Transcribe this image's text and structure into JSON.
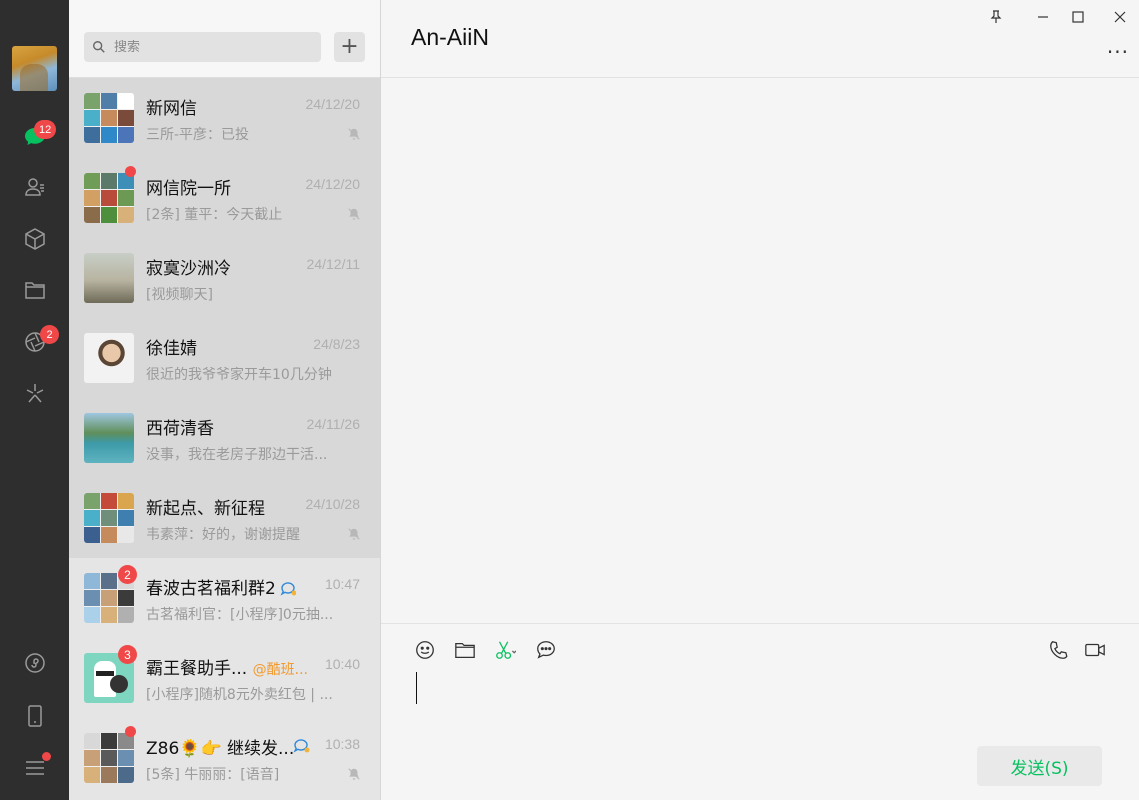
{
  "nav": {
    "chat_badge": "12",
    "moments_badge": "2"
  },
  "search": {
    "placeholder": "搜索"
  },
  "add_label": "+",
  "chats": [
    {
      "name": "新网信",
      "time": "24/12/20",
      "preview": "三所-平彦：已投",
      "muted": true
    },
    {
      "name": "网信院一所",
      "time": "24/12/20",
      "preview": "[2条] 董平：今天截止",
      "muted": true
    },
    {
      "name": "寂寞沙洲冷",
      "time": "24/12/11",
      "preview": "[视频聊天]",
      "muted": false
    },
    {
      "name": "徐佳婧",
      "time": "24/8/23",
      "preview": "很近的我爷爷家开车10几分钟",
      "muted": false
    },
    {
      "name": "西荷清香",
      "time": "24/11/26",
      "preview": "没事，我在老房子那边干活...",
      "muted": false
    },
    {
      "name": "新起点、新征程",
      "time": "24/10/28",
      "preview": "韦素萍：好的，谢谢提醒",
      "muted": true
    },
    {
      "name": "春波古茗福利群2",
      "time": "10:47",
      "preview": "古茗福利官：[小程序]0元抽...",
      "badge": "2",
      "muted": false
    },
    {
      "name": "霸王餐助手...",
      "mention": "@酷班...",
      "time": "10:40",
      "preview": "[小程序]随机8元外卖红包 | ...",
      "badge": "3",
      "muted": false
    },
    {
      "name": "Z86🌻👉 继续发...",
      "time": "10:38",
      "preview": "[5条] 牛丽丽：[语音]",
      "muted": true
    }
  ],
  "main": {
    "title": "An-AiiN",
    "more": "···",
    "send_label": "发送(S)"
  },
  "colors": {
    "accent": "#07c160",
    "badge": "#f04848",
    "nav_bg": "#2e2e2e"
  }
}
